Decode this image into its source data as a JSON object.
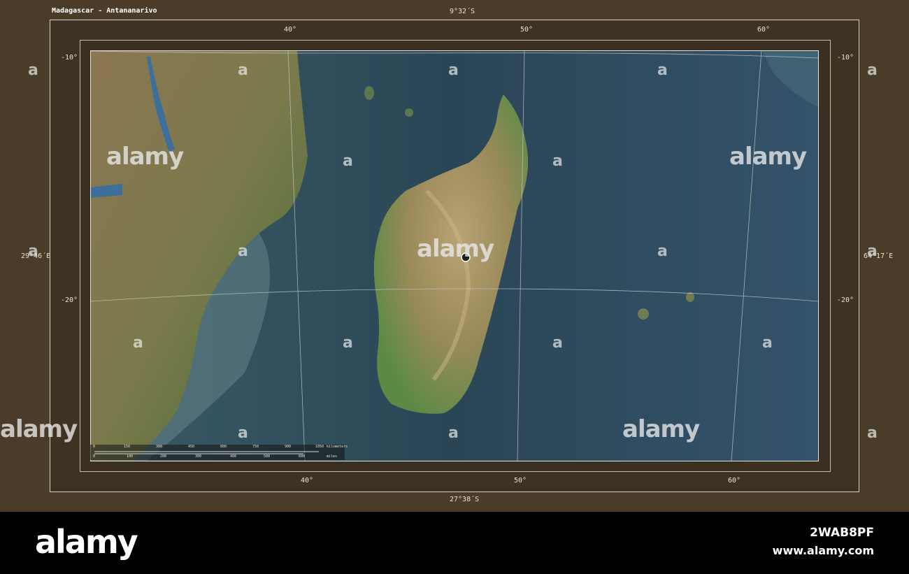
{
  "map": {
    "title": "Madagascar - Antananarivo",
    "bounds": {
      "north": "9°32´S",
      "south": "27°38´S",
      "west": "29°46´E",
      "east": "64°17´E"
    },
    "lon_ticks_top": [
      "40°",
      "50°",
      "60°"
    ],
    "lon_ticks_bottom": [
      "40°",
      "50°",
      "60°"
    ],
    "lat_ticks_left": [
      "-10°",
      "-20°"
    ],
    "lat_ticks_right": [
      "-10°",
      "-20°"
    ],
    "marker": "Antananarivo",
    "colors": {
      "sea": "#2f4b5c",
      "lowland": "#4f7a3e",
      "highland": "#9d8a5e",
      "frame": "#4a3c28"
    }
  },
  "scale": {
    "km_labels": [
      "0",
      "150",
      "300",
      "450",
      "600",
      "750",
      "900",
      "1050"
    ],
    "km_unit": "kilometers",
    "mi_labels": [
      "0",
      "100",
      "200",
      "300",
      "400",
      "500",
      "600"
    ],
    "mi_unit": "miles"
  },
  "watermark": {
    "word": "alamy",
    "letter": "a"
  },
  "footer": {
    "logo": "alamy",
    "image_id": "2WAB8PF",
    "url": "www.alamy.com"
  }
}
